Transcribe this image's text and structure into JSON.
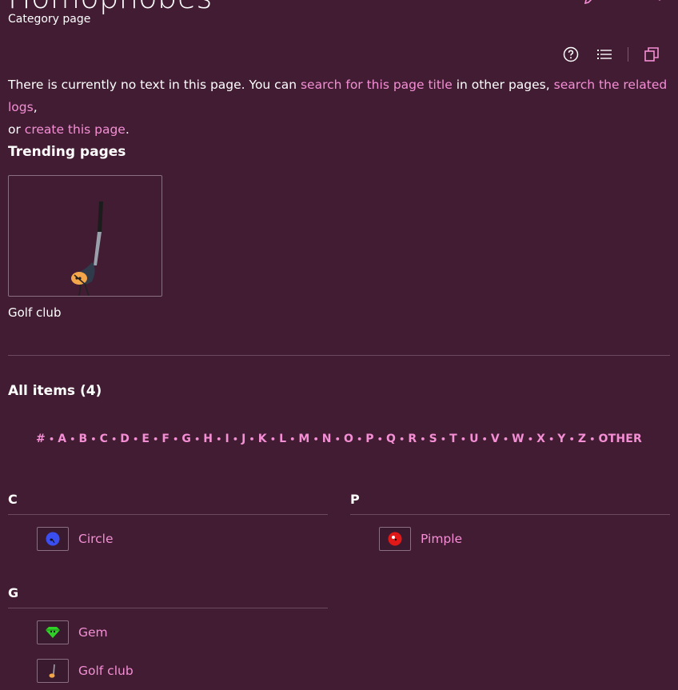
{
  "page": {
    "title": "Homophobes",
    "subtitle": "Category page"
  },
  "intro": {
    "text1": "There is currently no text in this page. You can ",
    "link1": "search for this page title",
    "text2": " in other pages, ",
    "link2": "search the related logs",
    "text3": ",",
    "text4": "or ",
    "link3": "create this page",
    "text5": "."
  },
  "trending": {
    "heading": "Trending pages",
    "items": [
      {
        "label": "Golf club"
      }
    ]
  },
  "all_items": {
    "heading": "All items (4)",
    "alphabet": [
      "#",
      "A",
      "B",
      "C",
      "D",
      "E",
      "F",
      "G",
      "H",
      "I",
      "J",
      "K",
      "L",
      "M",
      "N",
      "O",
      "P",
      "Q",
      "R",
      "S",
      "T",
      "U",
      "V",
      "W",
      "X",
      "Y",
      "Z",
      "OTHER"
    ],
    "groups": [
      {
        "letter": "C",
        "items": [
          {
            "label": "Circle",
            "icon": "circle-character-icon"
          }
        ]
      },
      {
        "letter": "P",
        "items": [
          {
            "label": "Pimple",
            "icon": "pimple-character-icon"
          }
        ]
      },
      {
        "letter": "G",
        "items": [
          {
            "label": "Gem",
            "icon": "gem-character-icon"
          },
          {
            "label": "Golf club",
            "icon": "golf-club-character-icon"
          }
        ]
      }
    ]
  },
  "colors": {
    "background": "#411c33",
    "link": "#f58fd5",
    "divider": "#6b4a5e"
  }
}
